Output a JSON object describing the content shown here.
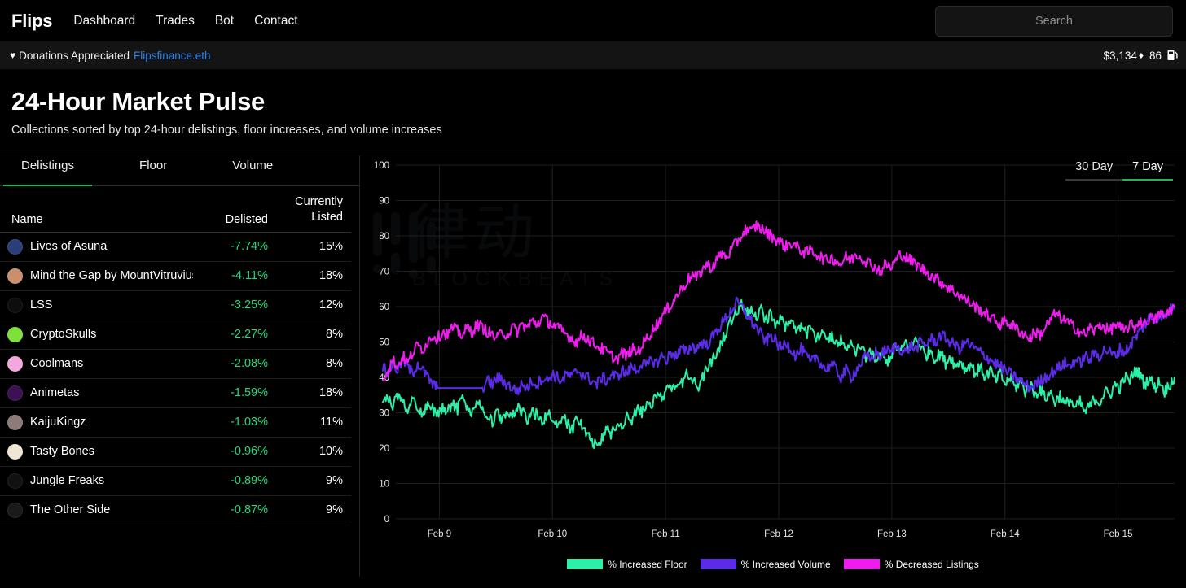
{
  "nav": {
    "brand": "Flips",
    "links": [
      {
        "label": "Dashboard",
        "name": "nav-link-dashboard"
      },
      {
        "label": "Trades",
        "name": "nav-link-trades"
      },
      {
        "label": "Bot",
        "name": "nav-link-bot"
      },
      {
        "label": "Contact",
        "name": "nav-link-contact"
      }
    ],
    "search_placeholder": "Search",
    "search_value": ""
  },
  "donation": {
    "heart": "♥",
    "text": "Donations Appreciated",
    "link": "Flipsfinance.eth",
    "eth_price": "$3,134",
    "eth_symbol": "♦",
    "gas": "86"
  },
  "page": {
    "title": "24-Hour Market Pulse",
    "subtitle": "Collections sorted by top 24-hour delistings, floor increases, and volume increases"
  },
  "tabs": [
    {
      "label": "Delistings",
      "active": true
    },
    {
      "label": "Floor",
      "active": false
    },
    {
      "label": "Volume",
      "active": false
    }
  ],
  "table": {
    "headers": {
      "name": "Name",
      "delisted": "Delisted",
      "listed_line1": "Currently",
      "listed_line2": "Listed"
    },
    "rows": [
      {
        "name": "Lives of Asuna",
        "delisted": "-7.74%",
        "listed": "15%",
        "avatar": "#2b3e78"
      },
      {
        "name": "Mind the Gap by MountVitruvius",
        "delisted": "-4.11%",
        "listed": "18%",
        "avatar": "#c98f6e"
      },
      {
        "name": "LSS",
        "delisted": "-3.25%",
        "listed": "12%",
        "avatar": "#0d0d0d"
      },
      {
        "name": "CryptoSkulls",
        "delisted": "-2.27%",
        "listed": "8%",
        "avatar": "#7ee03a"
      },
      {
        "name": "Coolmans",
        "delisted": "-2.08%",
        "listed": "8%",
        "avatar": "#f2a8dd"
      },
      {
        "name": "Animetas",
        "delisted": "-1.59%",
        "listed": "18%",
        "avatar": "#3d1054"
      },
      {
        "name": "KaijuKingz",
        "delisted": "-1.03%",
        "listed": "11%",
        "avatar": "#8e7a79"
      },
      {
        "name": "Tasty Bones",
        "delisted": "-0.96%",
        "listed": "10%",
        "avatar": "#efe7d4"
      },
      {
        "name": "Jungle Freaks",
        "delisted": "-0.89%",
        "listed": "9%",
        "avatar": "#111111"
      },
      {
        "name": "The Other Side",
        "delisted": "-0.87%",
        "listed": "9%",
        "avatar": "#1a1a1a"
      }
    ]
  },
  "range": [
    {
      "label": "30 Day",
      "active": false
    },
    {
      "label": "7 Day",
      "active": true
    }
  ],
  "watermark": {
    "cjk": "律动",
    "latin": "BLOCKBEATS"
  },
  "colors": {
    "floor": "#2DF0A8",
    "volume": "#5B2BE8",
    "listings": "#EE1DEE",
    "accent_green": "#1db954",
    "link_blue": "#2f80ed",
    "value_green": "#21d87a"
  },
  "chart_data": {
    "type": "line",
    "title": "",
    "xlabel": "",
    "ylabel": "",
    "ylim": [
      0,
      100
    ],
    "yticks": [
      0,
      10,
      20,
      30,
      40,
      50,
      60,
      70,
      80,
      90,
      100
    ],
    "xtick_labels": [
      "Feb 9",
      "Feb 10",
      "Feb 11",
      "Feb 12",
      "Feb 13",
      "Feb 14",
      "Feb 15"
    ],
    "grid": true,
    "legend_position": "bottom",
    "series": [
      {
        "name": "% Increased Floor",
        "color": "#2DF0A8",
        "values": [
          33,
          34,
          32,
          35,
          33,
          31,
          34,
          32,
          30,
          33,
          31,
          29,
          32,
          30,
          33,
          31,
          34,
          32,
          30,
          33,
          31,
          29,
          27,
          30,
          28,
          31,
          29,
          32,
          30,
          28,
          31,
          29,
          27,
          30,
          28,
          26,
          29,
          27,
          25,
          28,
          26,
          24,
          22,
          20,
          23,
          25,
          24,
          27,
          26,
          29,
          28,
          31,
          30,
          33,
          32,
          35,
          34,
          37,
          36,
          39,
          38,
          41,
          40,
          37,
          39,
          42,
          44,
          47,
          50,
          53,
          56,
          59,
          61,
          58,
          60,
          57,
          59,
          56,
          58,
          55,
          57,
          54,
          56,
          53,
          55,
          52,
          54,
          51,
          53,
          50,
          52,
          49,
          51,
          48,
          50,
          47,
          49,
          46,
          48,
          45,
          47,
          44,
          46,
          49,
          47,
          50,
          48,
          51,
          49,
          46,
          48,
          45,
          47,
          44,
          46,
          43,
          45,
          42,
          44,
          41,
          43,
          40,
          42,
          39,
          41,
          38,
          40,
          37,
          39,
          36,
          38,
          35,
          37,
          34,
          36,
          33,
          35,
          32,
          34,
          31,
          33,
          30,
          32,
          34,
          33,
          36,
          35,
          38,
          37,
          40,
          39,
          42,
          41,
          38,
          40,
          37,
          39,
          36,
          38,
          40
        ]
      },
      {
        "name": "% Increased Volume",
        "color": "#5B2BE8",
        "values": [
          43,
          41,
          44,
          42,
          45,
          43,
          41,
          44,
          42,
          40,
          38,
          37,
          37,
          37,
          37,
          37,
          37,
          37,
          37,
          37,
          37,
          39,
          38,
          40,
          39,
          38,
          37,
          36,
          38,
          37,
          39,
          38,
          40,
          39,
          41,
          40,
          39,
          41,
          40,
          42,
          41,
          40,
          39,
          38,
          40,
          39,
          41,
          40,
          42,
          41,
          43,
          42,
          44,
          43,
          45,
          44,
          46,
          45,
          47,
          46,
          48,
          47,
          49,
          48,
          50,
          49,
          51,
          53,
          55,
          57,
          59,
          61,
          60,
          58,
          56,
          54,
          52,
          50,
          52,
          50,
          48,
          50,
          48,
          46,
          48,
          46,
          44,
          46,
          44,
          42,
          44,
          42,
          40,
          42,
          40,
          42,
          44,
          46,
          45,
          47,
          46,
          48,
          47,
          49,
          48,
          47,
          49,
          48,
          50,
          49,
          51,
          50,
          52,
          51,
          50,
          49,
          48,
          50,
          49,
          48,
          47,
          46,
          45,
          44,
          43,
          42,
          41,
          40,
          39,
          38,
          37,
          38,
          39,
          40,
          41,
          42,
          43,
          44,
          43,
          45,
          44,
          46,
          45,
          47,
          46,
          48,
          47,
          46,
          48,
          47,
          49,
          51,
          53,
          55,
          57,
          56,
          58,
          57,
          59,
          60
        ]
      },
      {
        "name": "% Decreased Listings",
        "color": "#EE1DEE",
        "values": [
          40,
          42,
          45,
          43,
          46,
          44,
          47,
          49,
          48,
          50,
          52,
          51,
          53,
          52,
          54,
          53,
          52,
          54,
          53,
          55,
          54,
          53,
          52,
          51,
          53,
          52,
          54,
          53,
          55,
          54,
          56,
          55,
          57,
          56,
          55,
          54,
          53,
          52,
          51,
          50,
          52,
          51,
          50,
          49,
          48,
          47,
          46,
          45,
          47,
          46,
          48,
          47,
          49,
          51,
          53,
          55,
          57,
          59,
          61,
          63,
          65,
          67,
          69,
          68,
          70,
          72,
          71,
          73,
          75,
          74,
          76,
          78,
          80,
          82,
          81,
          83,
          82,
          81,
          80,
          79,
          78,
          77,
          78,
          77,
          76,
          75,
          76,
          75,
          74,
          73,
          74,
          73,
          72,
          74,
          73,
          75,
          74,
          73,
          72,
          71,
          70,
          72,
          71,
          73,
          75,
          74,
          73,
          72,
          71,
          70,
          69,
          68,
          67,
          66,
          65,
          64,
          63,
          62,
          61,
          60,
          59,
          58,
          57,
          56,
          55,
          56,
          55,
          54,
          53,
          52,
          51,
          53,
          52,
          54,
          56,
          58,
          57,
          56,
          55,
          54,
          53,
          52,
          54,
          53,
          55,
          54,
          53,
          55,
          54,
          53,
          55,
          54,
          56,
          55,
          57,
          56,
          58,
          57,
          59,
          60
        ]
      }
    ]
  }
}
